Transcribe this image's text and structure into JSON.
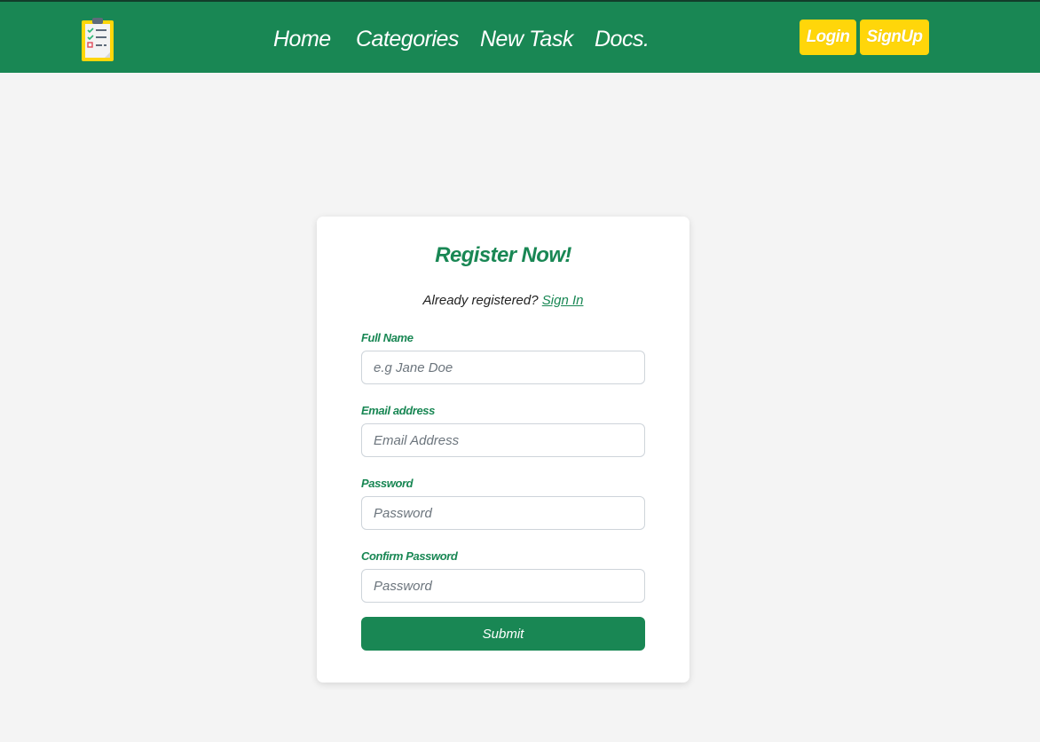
{
  "nav": {
    "links": [
      "Home",
      "Categories",
      "New Task",
      "Docs."
    ],
    "login_label": "Login",
    "signup_label": "SignUp",
    "logo_icon": "clipboard-checklist-icon"
  },
  "form": {
    "title": "Register Now!",
    "already_text": "Already registered?",
    "signin_label": "Sign In",
    "full_name_label": "Full Name",
    "full_name_placeholder": "e.g Jane Doe",
    "email_label": "Email address",
    "email_placeholder": "Email Address",
    "password_label": "Password",
    "password_placeholder": "Password",
    "confirm_label": "Confirm Password",
    "confirm_placeholder": "Password",
    "submit_label": "Submit"
  },
  "colors": {
    "primary_green": "#198754",
    "accent_yellow": "#ffd60a",
    "page_background": "#f4f4f4"
  }
}
